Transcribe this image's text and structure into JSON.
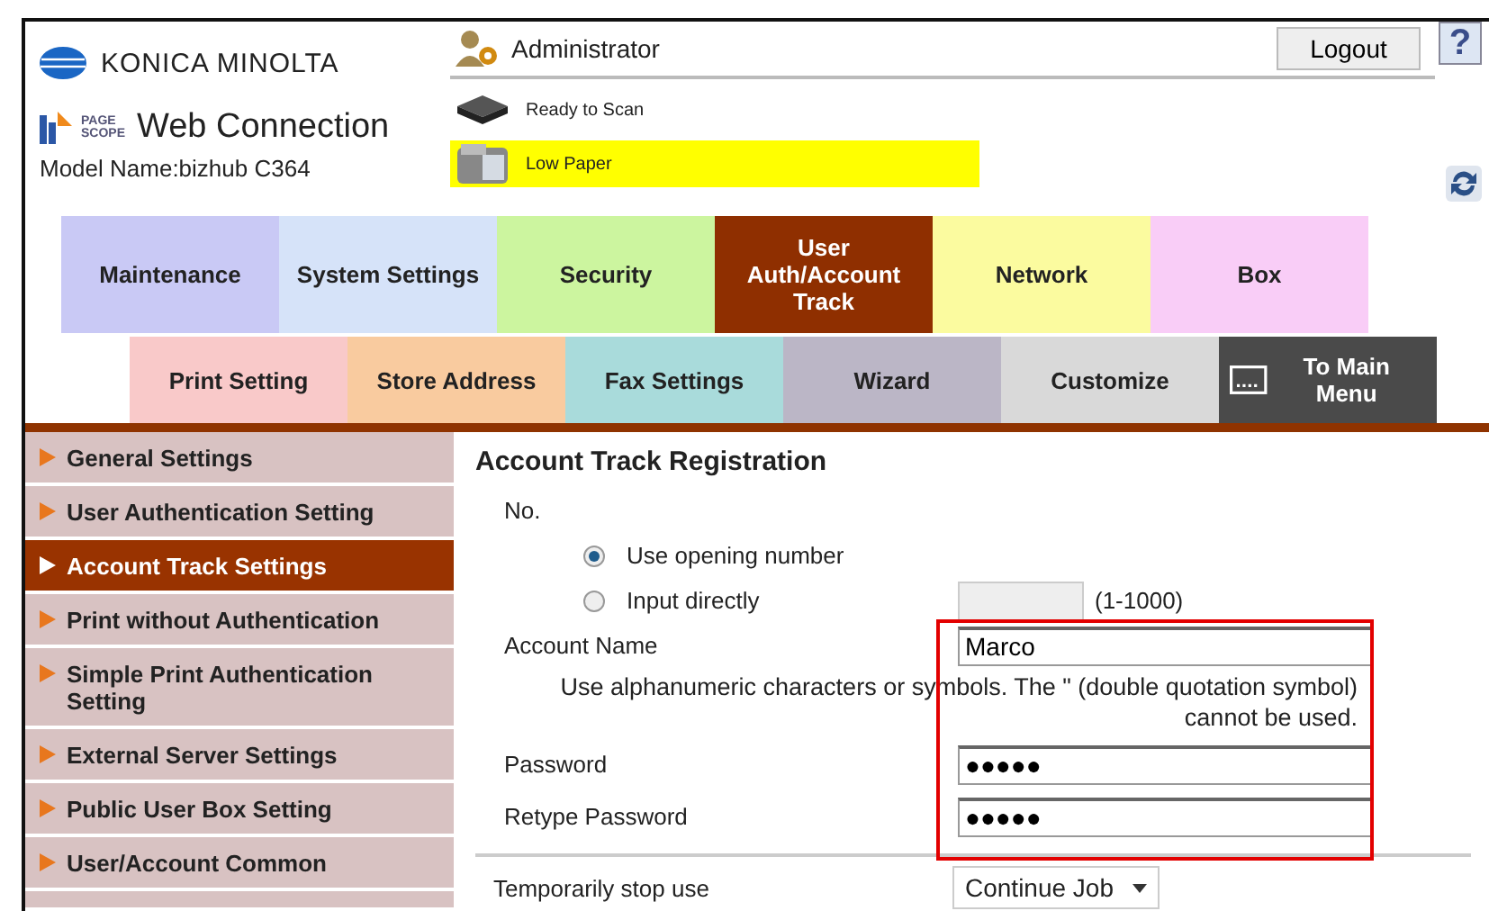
{
  "header": {
    "brand": "KONICA MINOLTA",
    "product": "Web Connection",
    "product_mark": "PAGE SCOPE",
    "model": "Model Name:bizhub C364",
    "user": "Administrator",
    "logout": "Logout",
    "help": "?",
    "statuses": [
      {
        "text": "Ready to Scan",
        "kind": "scanner",
        "alert": false
      },
      {
        "text": "Low Paper",
        "kind": "paper",
        "alert": true
      }
    ]
  },
  "tabs": [
    {
      "label": "Maintenance",
      "color": "#c9c9f5",
      "selected": false
    },
    {
      "label": "System Settings",
      "color": "#d6e3f9",
      "selected": false
    },
    {
      "label": "Security",
      "color": "#ccf59f",
      "selected": false
    },
    {
      "label": "User Auth/Account Track",
      "color": "#8f2f00",
      "selected": true
    },
    {
      "label": "Network",
      "color": "#fbfb9f",
      "selected": false
    },
    {
      "label": "Box",
      "color": "#f9cdf7",
      "selected": false
    }
  ],
  "subtabs": [
    {
      "label": "Print Setting",
      "color": "#f9c9c9",
      "kind": "text"
    },
    {
      "label": "Store Address",
      "color": "#f9cb9f",
      "kind": "text"
    },
    {
      "label": "Fax Settings",
      "color": "#a9dbdb",
      "kind": "text"
    },
    {
      "label": "Wizard",
      "color": "#bbb6c6",
      "kind": "text"
    },
    {
      "label": "Customize",
      "color": "#d9d9d9",
      "kind": "text"
    },
    {
      "label": "To Main Menu",
      "color": "#4a4a4a",
      "kind": "menu"
    }
  ],
  "sidebar": {
    "items": [
      {
        "label": "General Settings",
        "selected": false
      },
      {
        "label": "User Authentication Setting",
        "selected": false
      },
      {
        "label": "Account Track Settings",
        "selected": true
      },
      {
        "label": "Print without Authentication",
        "selected": false
      },
      {
        "label": "Simple Print Authentication Setting",
        "selected": false
      },
      {
        "label": "External Server Settings",
        "selected": false
      },
      {
        "label": "Public User Box Setting",
        "selected": false
      },
      {
        "label": "User/Account Common",
        "selected": false
      }
    ]
  },
  "form": {
    "title": "Account Track Registration",
    "number_label": "No.",
    "number_options": [
      {
        "label": "Use opening number",
        "selected": true
      },
      {
        "label": "Input directly",
        "selected": false
      }
    ],
    "number_range": "(1-1000)",
    "account_name_label": "Account Name",
    "account_name": "Marco",
    "account_name_hint": "Use alphanumeric characters or symbols. The \" (double quotation symbol) cannot be used.",
    "password_label": "Password",
    "password": "●●●●●",
    "retype_label": "Retype Password",
    "retype": "●●●●●",
    "stop_label": "Temporarily stop use",
    "stop_value": "Continue Job"
  }
}
